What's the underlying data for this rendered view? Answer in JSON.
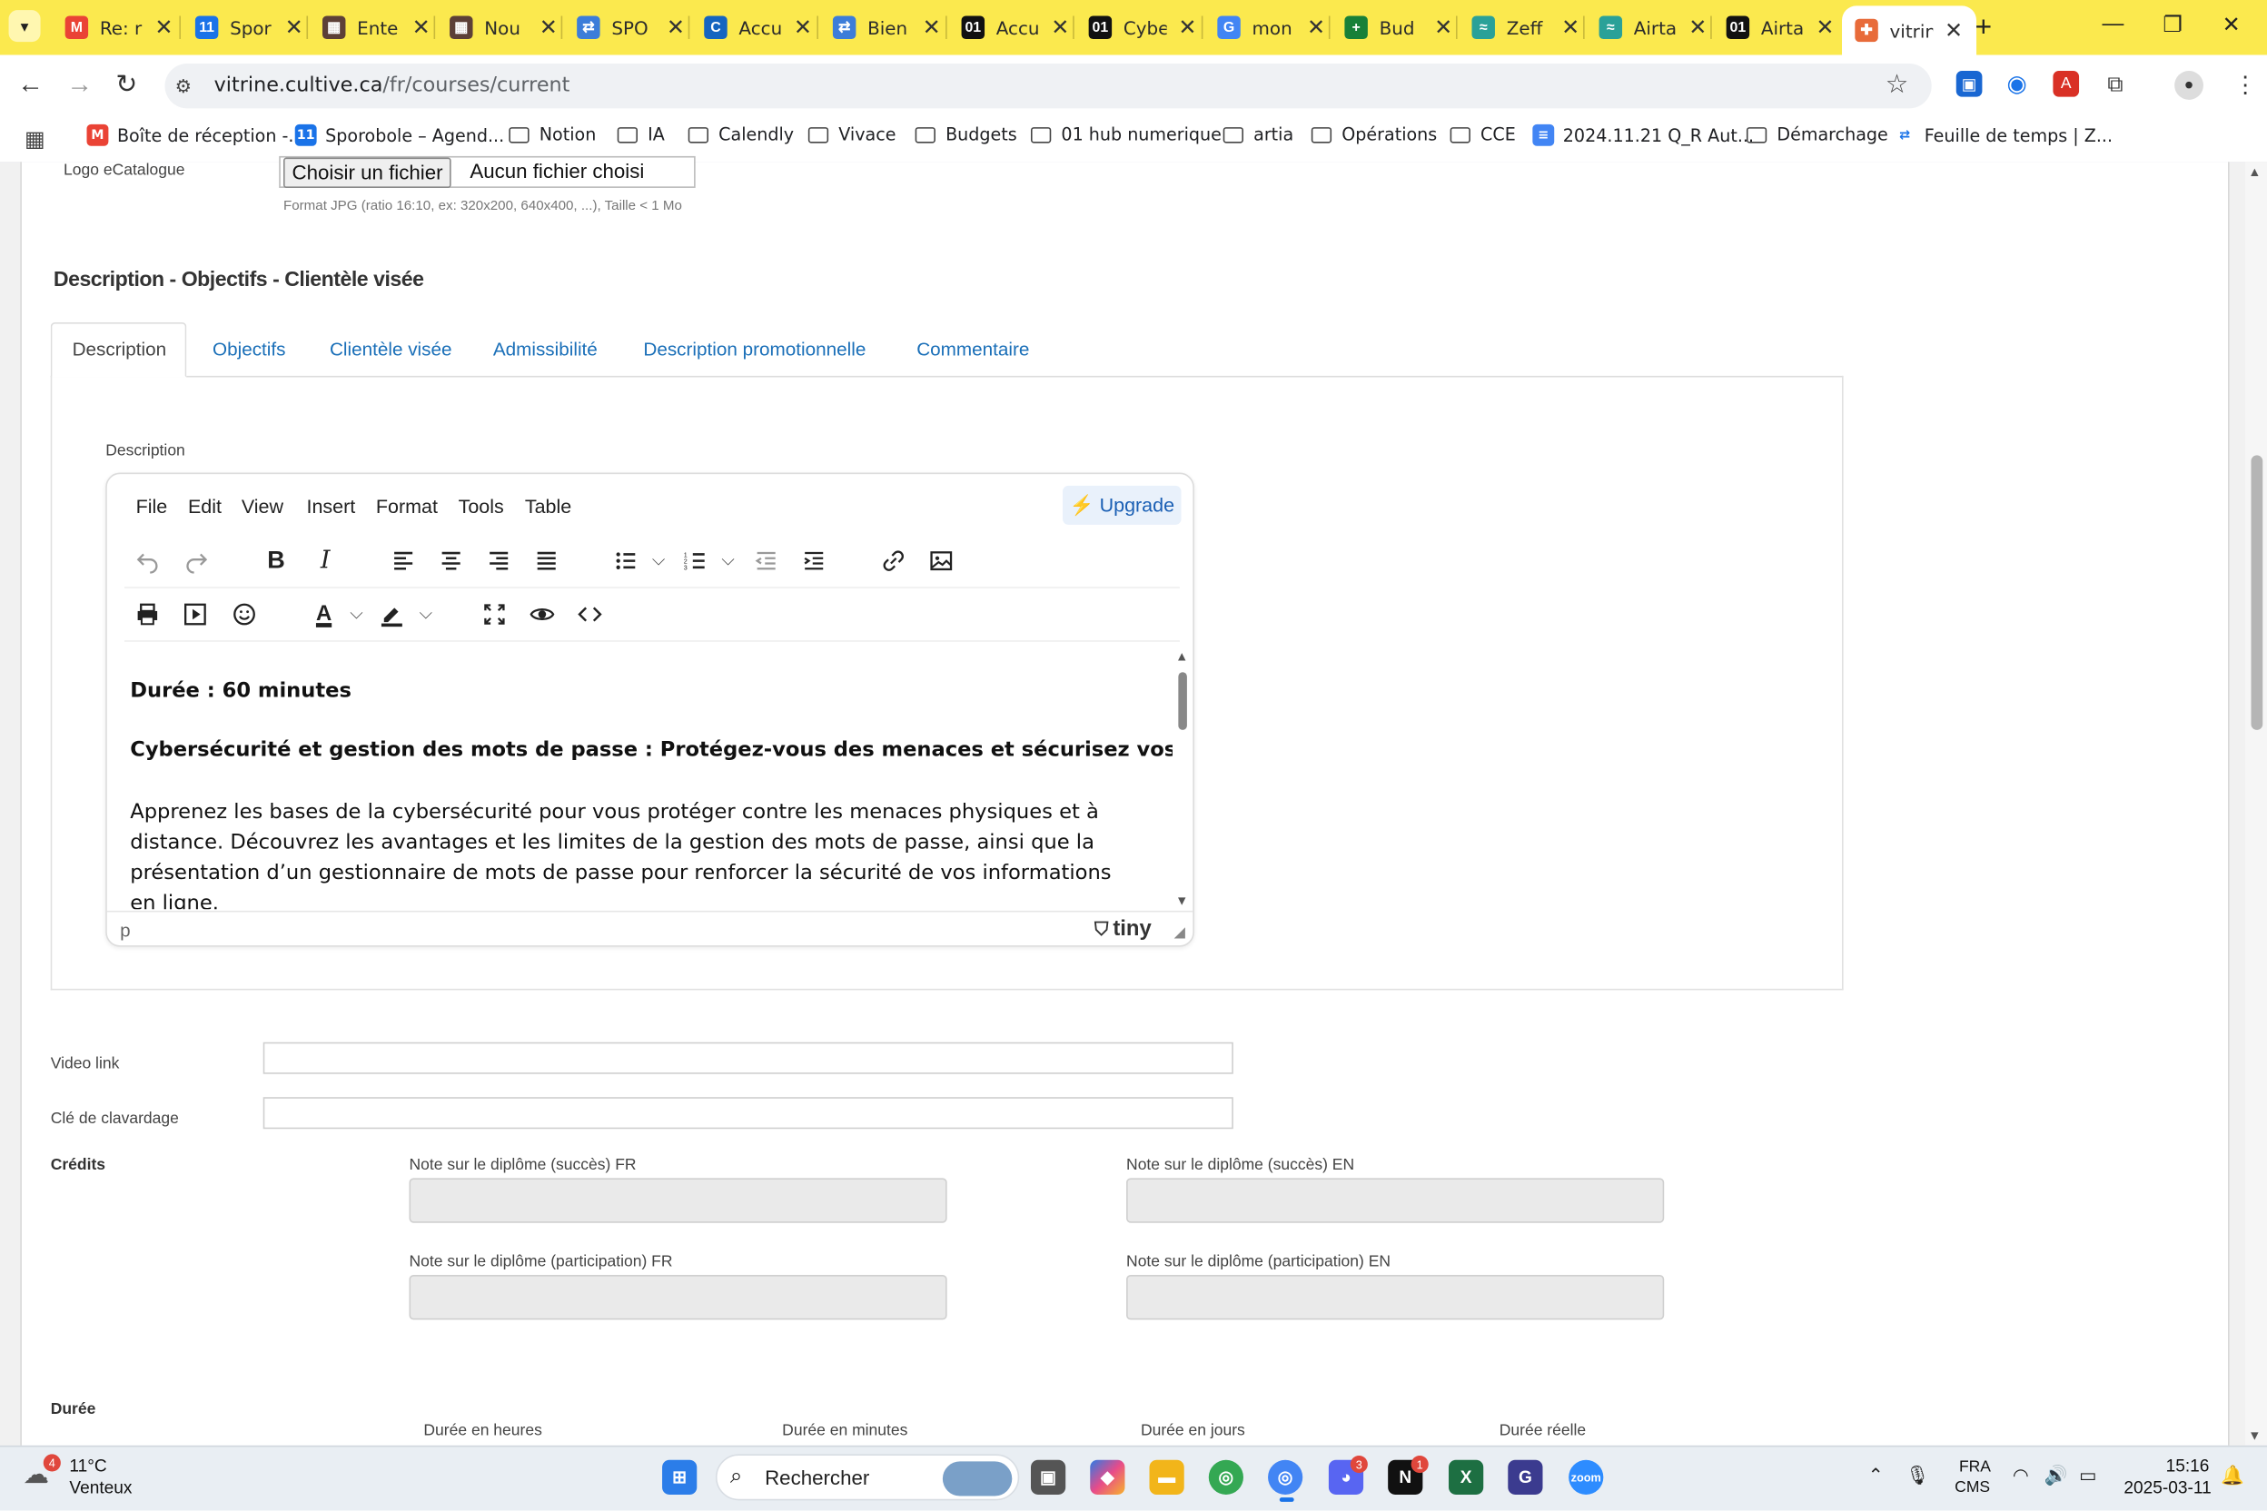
{
  "browser": {
    "tabs": [
      {
        "title": "Re: r",
        "fav_color": "#ea4335",
        "fav_glyph": "M"
      },
      {
        "title": "Spor",
        "fav_color": "#1a73e8",
        "fav_glyph": "11"
      },
      {
        "title": "Ente",
        "fav_color": "#5d4037",
        "fav_glyph": "▦"
      },
      {
        "title": "Nou",
        "fav_color": "#5d4037",
        "fav_glyph": "▦"
      },
      {
        "title": "SPO",
        "fav_color": "#3c7dd9",
        "fav_glyph": "⇄"
      },
      {
        "title": "Accu",
        "fav_color": "#1565c0",
        "fav_glyph": "C"
      },
      {
        "title": "Bien",
        "fav_color": "#3c7dd9",
        "fav_glyph": "⇄"
      },
      {
        "title": "Accu",
        "fav_color": "#111111",
        "fav_glyph": "01"
      },
      {
        "title": "Cybe",
        "fav_color": "#111111",
        "fav_glyph": "01"
      },
      {
        "title": "mon",
        "fav_color": "#4285f4",
        "fav_glyph": "G"
      },
      {
        "title": "Bud",
        "fav_color": "#188038",
        "fav_glyph": "+"
      },
      {
        "title": "Zeff",
        "fav_color": "#2aa198",
        "fav_glyph": "≈"
      },
      {
        "title": "Airta",
        "fav_color": "#2aa198",
        "fav_glyph": "≈"
      },
      {
        "title": "Airta",
        "fav_color": "#111111",
        "fav_glyph": "01"
      },
      {
        "title": "vitrin",
        "fav_color": "#e86b3a",
        "fav_glyph": "✚"
      }
    ],
    "url_host": "vitrine.cultive.ca",
    "url_path": "/fr/courses/current",
    "bookmarks": [
      {
        "label": "Boîte de réception -...",
        "type": "fav",
        "color": "#ea4335",
        "glyph": "M"
      },
      {
        "label": "Sporobole – Agend...",
        "type": "fav",
        "color": "#1a73e8",
        "glyph": "11"
      },
      {
        "label": "Notion",
        "type": "folder"
      },
      {
        "label": "IA",
        "type": "folder"
      },
      {
        "label": "Calendly",
        "type": "folder"
      },
      {
        "label": "Vivace",
        "type": "folder"
      },
      {
        "label": "Budgets",
        "type": "folder"
      },
      {
        "label": "01 hub numerique",
        "type": "folder"
      },
      {
        "label": "artia",
        "type": "folder"
      },
      {
        "label": "Opérations",
        "type": "folder"
      },
      {
        "label": "CCE",
        "type": "folder"
      },
      {
        "label": "2024.11.21 Q_R Aut...",
        "type": "fav",
        "color": "#4285f4",
        "glyph": "≡"
      },
      {
        "label": "Démarchage",
        "type": "folder"
      },
      {
        "label": "Feuille de temps | Z...",
        "type": "fav",
        "color": "#ffffff",
        "glyph": "⇄"
      }
    ]
  },
  "form": {
    "logo_label": "Logo eCatalogue",
    "file_choose": "Choisir un fichier",
    "file_none": "Aucun fichier choisi",
    "file_hint": "Format JPG (ratio 16:10, ex: 320x200, 640x400, ...), Taille < 1 Mo",
    "section_title": "Description - Objectifs - Clientèle visée",
    "tabs": [
      "Description",
      "Objectifs",
      "Clientèle visée",
      "Admissibilité",
      "Description promotionnelle",
      "Commentaire"
    ],
    "description_label": "Description",
    "video_label": "Video link",
    "chat_label": "Clé de clavardage",
    "credits_label": "Crédits",
    "note_success_fr": "Note sur le diplôme (succès) FR",
    "note_success_en": "Note sur le diplôme (succès) EN",
    "note_part_fr": "Note sur le diplôme (participation) FR",
    "note_part_en": "Note sur le diplôme (participation) EN",
    "duration_label": "Durée",
    "dur_hours": "Durée en heures",
    "dur_minutes": "Durée en minutes",
    "dur_days": "Durée en jours",
    "dur_real": "Durée réelle"
  },
  "editor": {
    "menu": [
      "File",
      "Edit",
      "View",
      "Insert",
      "Format",
      "Tools",
      "Table"
    ],
    "upgrade": "Upgrade",
    "content_line1": "Durée : 60 minutes",
    "content_line2": "Cybersécurité et gestion des mots de passe : Protégez-vous des menaces et sécurisez vos données",
    "content_para": "Apprenez les bases de la cybersécurité pour vous protéger contre les menaces physiques et à distance. Découvrez les avantages et les limites de la gestion des mots de passe, ainsi que la présentation d’un gestionnaire de mots de passe pour renforcer la sécurité de vos informations en ligne.",
    "status_path": "p",
    "brand": "tiny"
  },
  "taskbar": {
    "weather_temp": "11°C",
    "weather_desc": "Venteux",
    "weather_badge": "4",
    "search": "Rechercher",
    "lang": "FRA",
    "lang_sub": "CMS",
    "time": "15:16",
    "date": "2025-03-11",
    "discord_badge": "3",
    "notion_badge": "1"
  },
  "colors": {
    "chrome_accent": "#fbe94e",
    "link": "#1a6fb8"
  }
}
